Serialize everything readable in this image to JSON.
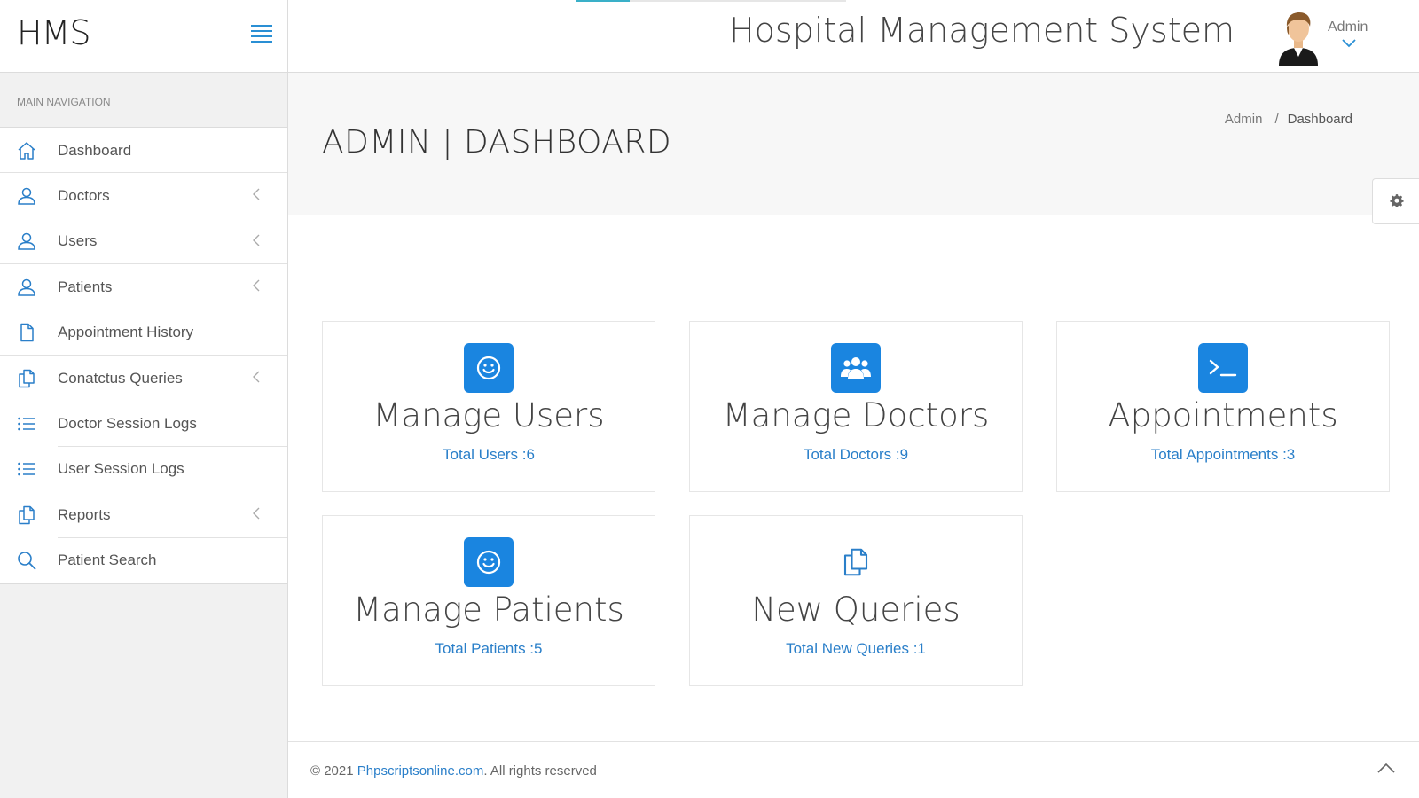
{
  "header": {
    "brand": "HMS",
    "app_title": "Hospital Management System",
    "user_name": "Admin",
    "icons": [
      "hamburger-menu-icon",
      "user-avatar",
      "chevron-down-icon"
    ]
  },
  "sidebar": {
    "heading": "MAIN NAVIGATION",
    "items": [
      {
        "label": "Dashboard",
        "icon": "home-icon",
        "has_submenu": false
      },
      {
        "label": "Doctors",
        "icon": "user-icon",
        "has_submenu": true
      },
      {
        "label": "Users",
        "icon": "user-icon",
        "has_submenu": true
      },
      {
        "label": "Patients",
        "icon": "user-icon",
        "has_submenu": true
      },
      {
        "label": "Appointment History",
        "icon": "file-icon",
        "has_submenu": false
      },
      {
        "label": "Conatctus Queries",
        "icon": "files-icon",
        "has_submenu": true
      },
      {
        "label": "Doctor Session Logs",
        "icon": "list-icon",
        "has_submenu": false
      },
      {
        "label": "User Session Logs",
        "icon": "list-icon",
        "has_submenu": false
      },
      {
        "label": "Reports",
        "icon": "files-icon",
        "has_submenu": true
      },
      {
        "label": "Patient Search",
        "icon": "search-icon",
        "has_submenu": false
      }
    ]
  },
  "page": {
    "title": "ADMIN | DASHBOARD",
    "breadcrumb": {
      "parent": "Admin",
      "separator": "/",
      "current": "Dashboard"
    }
  },
  "cards": [
    {
      "title": "Manage Users",
      "link": "Total Users :6",
      "icon": "smile-icon"
    },
    {
      "title": "Manage Doctors",
      "link": "Total Doctors :9",
      "icon": "users-group-icon"
    },
    {
      "title": "Appointments",
      "link": "Total Appointments :3",
      "icon": "terminal-icon"
    },
    {
      "title": "Manage Patients",
      "link": "Total Patients :5",
      "icon": "smile-icon"
    },
    {
      "title": "New Queries",
      "link": "Total New Queries :1",
      "icon": "files-icon"
    }
  ],
  "footer": {
    "prefix": "© 2021 ",
    "link": "Phpscriptsonline.com",
    "suffix": ". All rights reserved"
  },
  "colors": {
    "accent": "#1a85e0",
    "link": "#2a7fc9",
    "sidebar_bg": "#f1f1f1",
    "header_bg": "#f7f7f7"
  }
}
